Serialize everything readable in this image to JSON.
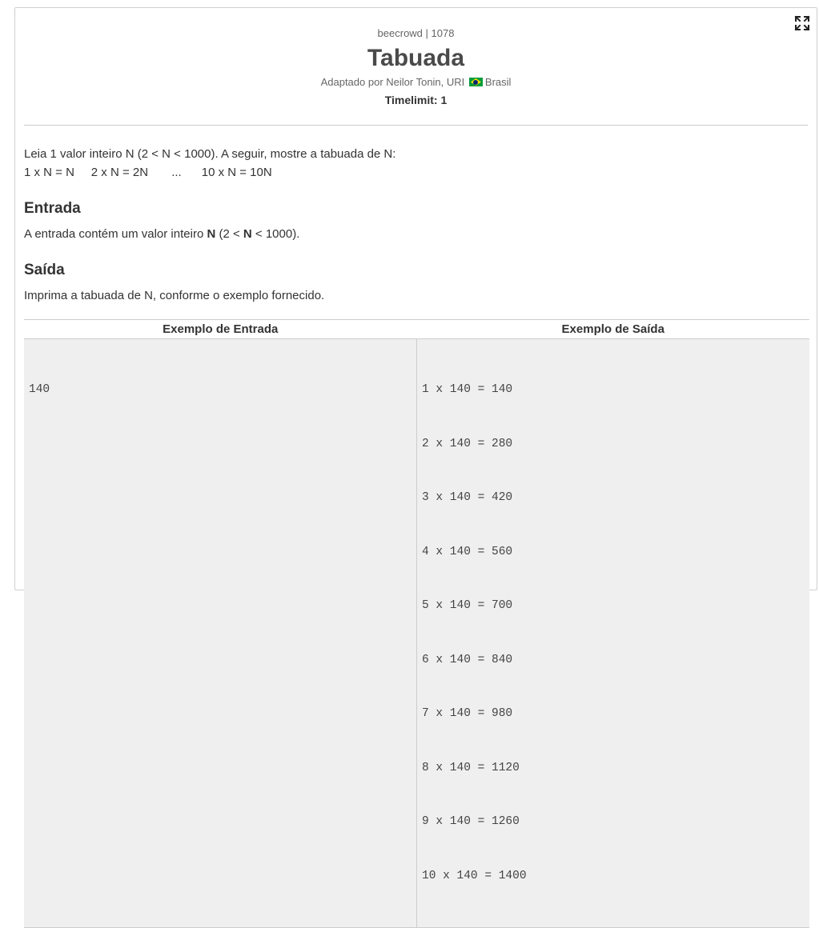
{
  "header": {
    "judge": "beecrowd | 1078",
    "title": "Tabuada",
    "author_prefix": "Adaptado por Neilor Tonin, URI",
    "author_country": "Brasil",
    "timelimit": "Timelimit: 1"
  },
  "description": {
    "text": "Leia 1 valor inteiro N (2 < N < 1000). A seguir, mostre a tabuada de N:",
    "formula": "1 x N = N     2 x N = 2N       ...      10 x N = 10N"
  },
  "input_section": {
    "heading": "Entrada",
    "text_before": "A entrada contém um valor inteiro ",
    "text_bold": "N",
    "text_middle": " (2 < ",
    "text_bold2": "N",
    "text_after": " < 1000)."
  },
  "output_section": {
    "heading": "Saída",
    "text": "Imprima a tabuada de N, conforme o exemplo fornecido."
  },
  "samples": {
    "input_header": "Exemplo de Entrada",
    "output_header": "Exemplo de Saída",
    "input_lines": [
      "140"
    ],
    "output_lines": [
      "1 x 140 = 140",
      "2 x 140 = 280",
      "3 x 140 = 420",
      "4 x 140 = 560",
      "5 x 140 = 700",
      "6 x 140 = 840",
      "7 x 140 = 980",
      "8 x 140 = 1120",
      "9 x 140 = 1260",
      "10 x 140 = 1400"
    ]
  },
  "icons": {
    "expand": "expand-icon",
    "flag": "brazil-flag-icon"
  }
}
